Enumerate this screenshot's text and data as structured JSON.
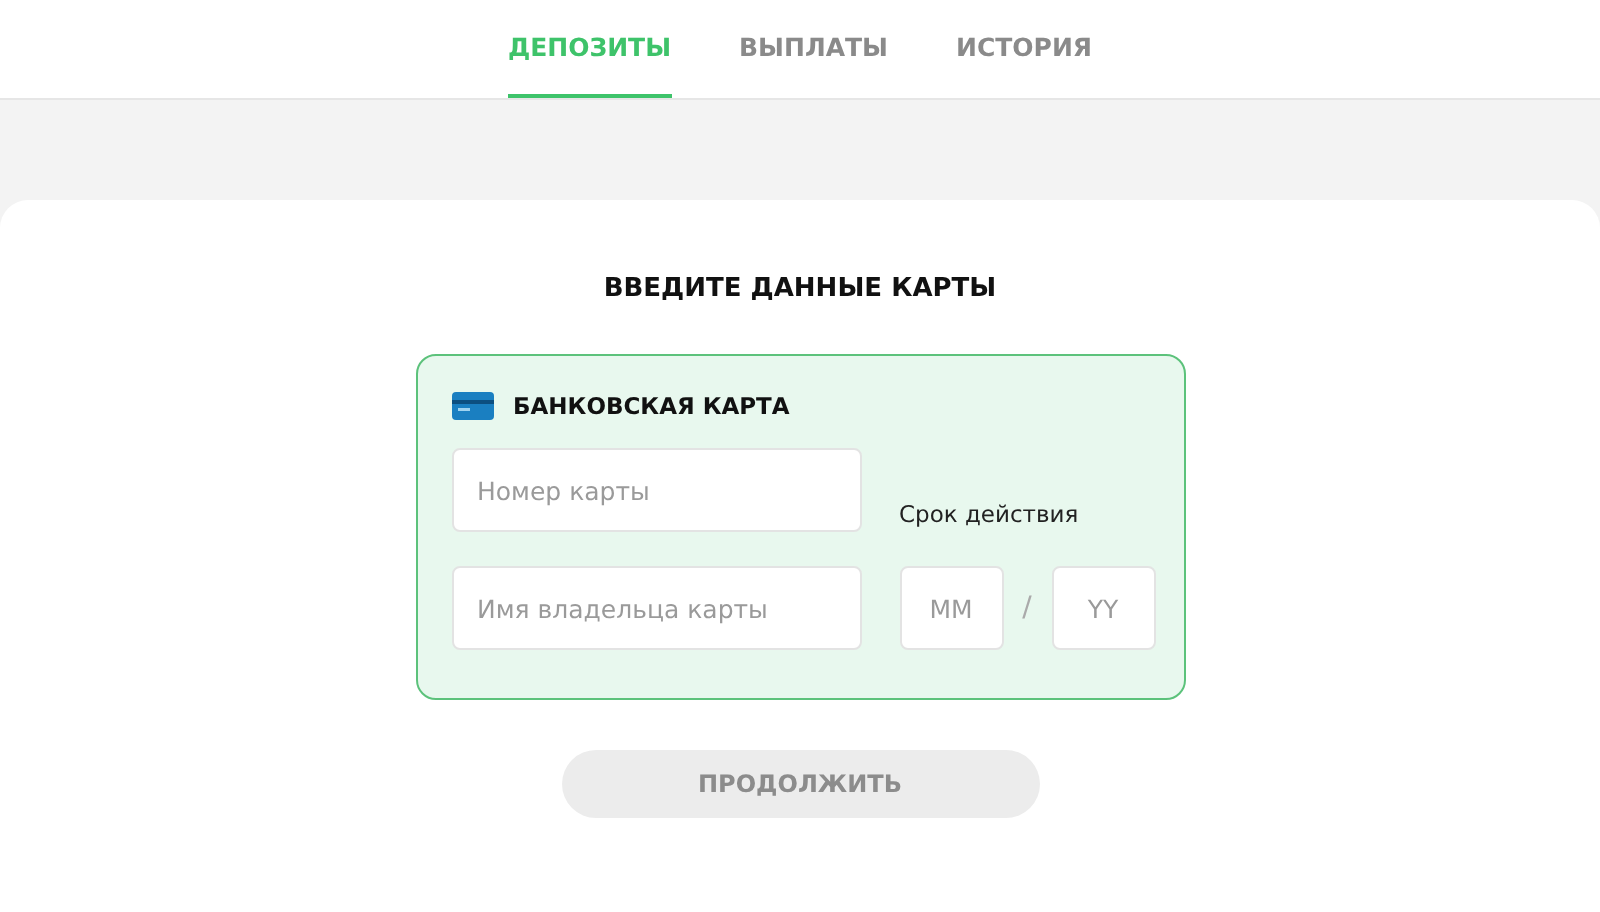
{
  "tabs": [
    {
      "label": "ДЕПОЗИТЫ",
      "selected": true
    },
    {
      "label": "ВЫПЛАТЫ",
      "selected": false
    },
    {
      "label": "ИСТОРИЯ",
      "selected": false
    }
  ],
  "heading": "ВВЕДИТЕ ДАННЫЕ КАРТЫ",
  "card_form": {
    "title": "БАНКОВСКАЯ КАРТА",
    "card_number": {
      "placeholder": "Номер карты"
    },
    "holder_name": {
      "placeholder": "Имя владельца карты"
    },
    "expiry_label": "Срок действия",
    "month": {
      "placeholder": "MM"
    },
    "separator": "/",
    "year": {
      "placeholder": "YY"
    }
  },
  "continue_button": {
    "label": "ПРОДОЛЖИТЬ",
    "disabled": true
  }
}
